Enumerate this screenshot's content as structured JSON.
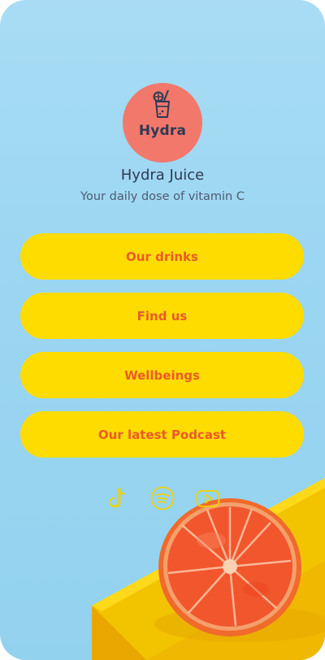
{
  "profile": {
    "logo_text": "Hydra",
    "name": "Hydra Juice",
    "tagline": "Your daily dose of vitamin C"
  },
  "links": [
    {
      "label": "Our drinks"
    },
    {
      "label": "Find us"
    },
    {
      "label": "Wellbeings"
    },
    {
      "label": "Our latest Podcast"
    }
  ],
  "social": [
    "tiktok-icon",
    "spotify-icon",
    "youtube-icon"
  ],
  "colors": {
    "background": "#9bd6f2",
    "button": "#ffdc00",
    "button_text": "#ea5a2a",
    "logo_circle": "#f2786c",
    "icon_stroke": "#f2d200",
    "title_text": "#2f3a52"
  }
}
